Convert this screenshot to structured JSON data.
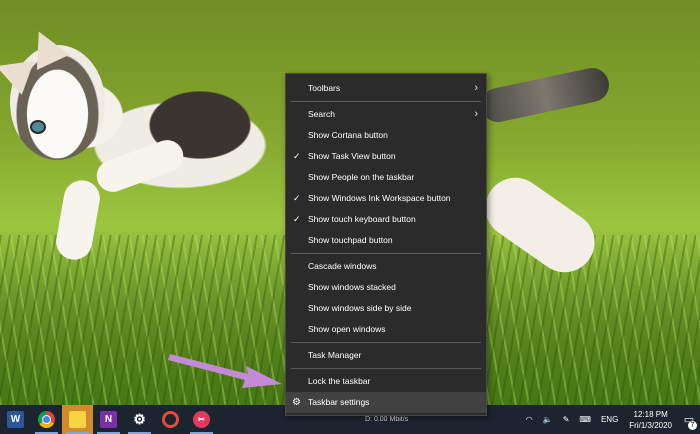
{
  "menu": {
    "toolbars": "Toolbars",
    "search": "Search",
    "show_cortana": "Show Cortana button",
    "show_task_view": "Show Task View button",
    "show_people": "Show People on the taskbar",
    "show_ink_workspace": "Show Windows Ink Workspace button",
    "show_touch_keyboard": "Show touch keyboard button",
    "show_touchpad": "Show touchpad button",
    "cascade": "Cascade windows",
    "stacked": "Show windows stacked",
    "side_by_side": "Show windows side by side",
    "show_desktop": "Show open windows",
    "task_manager": "Task Manager",
    "lock_taskbar": "Lock the taskbar",
    "taskbar_settings": "Taskbar settings",
    "checked_glyph": "✓"
  },
  "taskbar": {
    "apps": [
      "word-icon",
      "chrome-icon",
      "sticky-notes-icon",
      "onenote-icon",
      "settings-icon",
      "photos-icon",
      "app-icon"
    ],
    "status_text": "D:      0.00 Mbit/s",
    "language": "ENG",
    "time": "12:18 PM",
    "date": "Fri/1/3/2020",
    "notification_count": "7"
  },
  "colors": {
    "menu_bg": "#2b2b2b",
    "taskbar_bg": "#1c2430",
    "arrow": "#c98be0"
  }
}
